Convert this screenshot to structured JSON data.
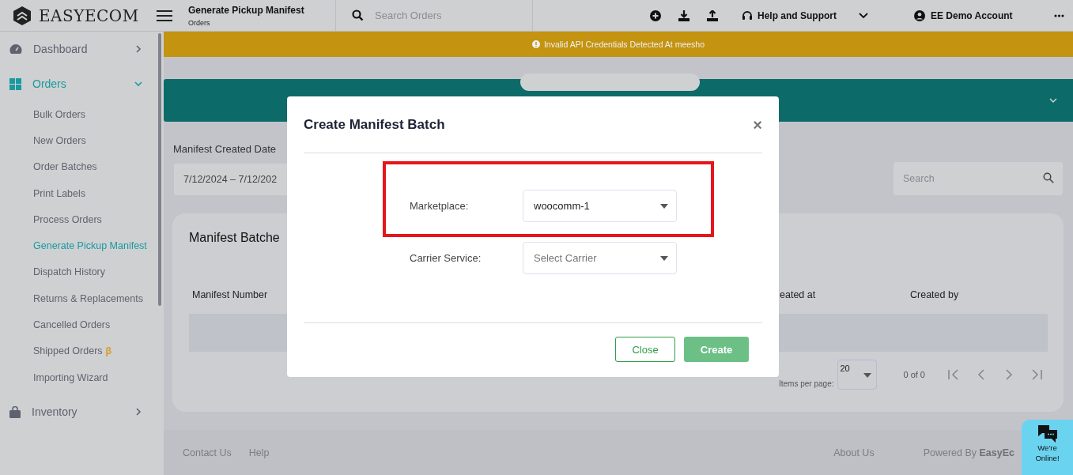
{
  "header": {
    "logo": "EASYECOM",
    "page_title": "Generate Pickup Manifest",
    "breadcrumb": "Orders",
    "search": {
      "placeholder": "Search Orders"
    },
    "help": "Help and Support",
    "account": "EE Demo Account"
  },
  "banner": {
    "message": "Invalid API Credentials Detected At meesho"
  },
  "sidebar": {
    "items": [
      {
        "label": "Dashboard",
        "expanded": false,
        "selected": false
      },
      {
        "label": "Orders",
        "expanded": true,
        "selected": true,
        "children": [
          {
            "label": "Bulk Orders",
            "selected": false
          },
          {
            "label": "New Orders",
            "selected": false
          },
          {
            "label": "Order Batches",
            "selected": false
          },
          {
            "label": "Print Labels",
            "selected": false
          },
          {
            "label": "Process Orders",
            "selected": false
          },
          {
            "label": "Generate Pickup Manifest",
            "selected": true
          },
          {
            "label": "Dispatch History",
            "selected": false
          },
          {
            "label": "Returns & Replacements",
            "selected": false
          },
          {
            "label": "Cancelled Orders",
            "selected": false
          },
          {
            "label": "Shipped Orders",
            "badge": "β",
            "selected": false
          },
          {
            "label": "Importing Wizard",
            "selected": false
          }
        ]
      },
      {
        "label": "Inventory",
        "expanded": false,
        "selected": false
      }
    ]
  },
  "filters": {
    "date_label": "Manifest Created Date",
    "date_range": "7/12/2024 – 7/12/202",
    "search": {
      "placeholder": "Search"
    }
  },
  "card": {
    "title": "Manifest Batche",
    "columns": [
      "Manifest Number",
      "eated at",
      "Created by"
    ],
    "pagination": {
      "items_label": "Items per page:",
      "page_size": "20",
      "range": "0 of 0"
    }
  },
  "footer": {
    "links": [
      "Contact Us",
      "Help",
      "About Us"
    ],
    "powered_by": "Powered By **EasyEc**"
  },
  "modal": {
    "title": "Create Manifest Batch",
    "close": "×",
    "fields": [
      {
        "label": "Marketplace:",
        "value": "woocomm-1"
      },
      {
        "label": "Carrier Service:",
        "placeholder": "Select Carrier"
      }
    ],
    "buttons": [
      {
        "label": "Close",
        "kind": "outline"
      },
      {
        "label": "Create",
        "kind": "primary"
      }
    ]
  },
  "chat": {
    "lines": [
      "We're",
      "Online!"
    ]
  }
}
